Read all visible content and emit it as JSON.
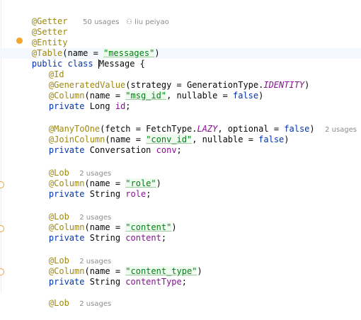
{
  "class_header": {
    "usages": "50 usages",
    "author": "liu peiyao"
  },
  "code": {
    "getter": "@Getter",
    "setter": "@Setter",
    "entity": "@Entity",
    "table_ann": "@Table",
    "table_name_arg": "(name = ",
    "table_name": "\"messages\"",
    "table_close": ")",
    "public": "public",
    "class": "class",
    "class_name_m": "M",
    "class_name_rest": "essage {",
    "id_ann": "@Id",
    "gen_ann": "@GeneratedValue",
    "gen_args": "(strategy = GenerationType.",
    "gen_identity": "IDENTITY",
    "gen_close": ")",
    "col1_ann": "@Column",
    "col1_open": "(name = ",
    "col1_name": "\"msg_id\"",
    "col1_rest": ", nullable = ",
    "col1_false": "false",
    "col1_close": ")",
    "private1": "private",
    "id_type": " Long ",
    "id_field": "id",
    "semicolon": ";",
    "mto_ann": "@ManyToOne",
    "mto_open": "(fetch = FetchType.",
    "mto_lazy": "LAZY",
    "mto_mid": ", optional = ",
    "mto_false": "false",
    "mto_close": ")",
    "mto_usages": "2 usages",
    "jc_ann": "@JoinColumn",
    "jc_open": "(name = ",
    "jc_name": "\"conv_id\"",
    "jc_rest": ", nullable = ",
    "jc_false": "false",
    "jc_close": ")",
    "private2": "private",
    "conv_type": " Conversation ",
    "conv_field": "conv",
    "lob1": "@Lob",
    "lob1_usages": "2 usages",
    "col_role_ann": "@Column",
    "col_role_open": "(name = ",
    "col_role_name": "\"role\"",
    "col_role_close": ")",
    "private3": "private",
    "role_type": " String ",
    "role_field": "role",
    "lob2": "@Lob",
    "lob2_usages": "2 usages",
    "col_content_ann": "@Column",
    "col_content_open": "(name = ",
    "col_content_name": "\"content\"",
    "col_content_close": ")",
    "private4": "private",
    "content_type_t": " String ",
    "content_field": "content",
    "lob3": "@Lob",
    "lob3_usages": "2 usages",
    "col_ct_ann": "@Column",
    "col_ct_open": "(name = ",
    "col_ct_name": "\"content_type\"",
    "col_ct_close": ")",
    "private5": "private",
    "ct_type": " String ",
    "ct_field": "contentType",
    "lob4": "@Lob",
    "lob4_usages": "2 usages"
  },
  "colors": {
    "annotation": "#9e880d",
    "keyword": "#0033b3",
    "string": "#067d17",
    "field": "#871094"
  }
}
